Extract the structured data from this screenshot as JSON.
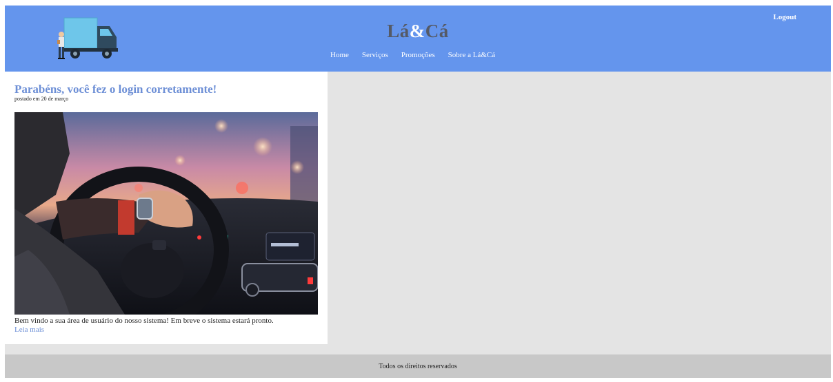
{
  "header": {
    "title_part1": "Lá",
    "title_amp": "&",
    "title_part2": "Cá",
    "logout_label": "Logout",
    "logo_icon": "delivery-truck-icon",
    "nav": [
      {
        "label": "Home"
      },
      {
        "label": "Serviços"
      },
      {
        "label": "Promoções"
      },
      {
        "label": "Sobre a Lá&Cá"
      }
    ]
  },
  "post": {
    "title": "Parabéns, você fez o login corretamente!",
    "date": "postado em 20 de março",
    "body": "Bem vindo a sua área de usuário do nosso sistema! Em breve o sistema estará pronto.",
    "read_more": "Leia mais"
  },
  "footer": {
    "text": "Todos os direitos reservados"
  },
  "colors": {
    "header_bg": "#6495ed",
    "main_bg": "#e4e4e4",
    "footer_bg": "#c8c8c8",
    "link": "#6d8fd6",
    "title": "#555a66"
  }
}
